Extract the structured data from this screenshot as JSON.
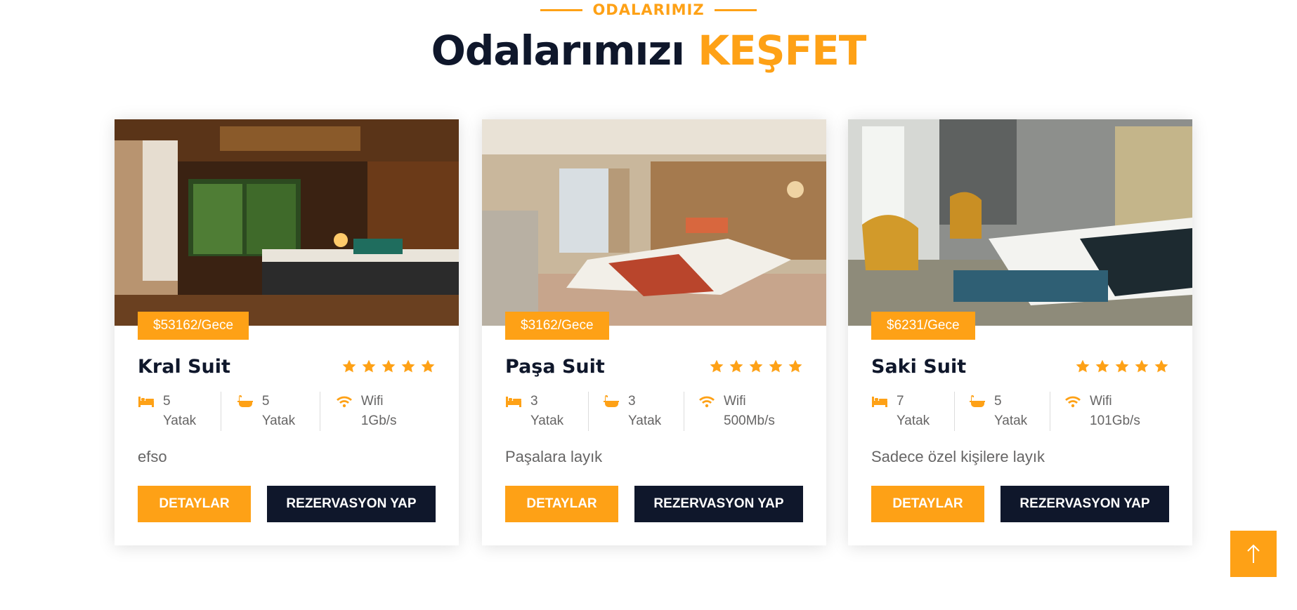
{
  "section": {
    "eyebrow": "ODALARIMIZ",
    "title_main": "Odalarımızı",
    "title_accent": "KEŞFET"
  },
  "colors": {
    "accent": "#fea116",
    "dark": "#0f172b",
    "text": "#666565"
  },
  "rooms": [
    {
      "price": "$53162/Gece",
      "name": "Kral Suit",
      "stars": 5,
      "beds": "5 Yatak",
      "baths": "5 Yatak",
      "wifi": "Wifi 1Gb/s",
      "description": "efso",
      "detail_label": "DETAYLAR",
      "reserve_label": "REZERVASYON YAP"
    },
    {
      "price": "$3162/Gece",
      "name": "Paşa Suit",
      "stars": 5,
      "beds": "3 Yatak",
      "baths": "3 Yatak",
      "wifi": "Wifi 500Mb/s",
      "description": "Paşalara layık",
      "detail_label": "DETAYLAR",
      "reserve_label": "REZERVASYON YAP"
    },
    {
      "price": "$6231/Gece",
      "name": "Saki Suit",
      "stars": 5,
      "beds": "7 Yatak",
      "baths": "5 Yatak",
      "wifi": "Wifi 101Gb/s",
      "description": "Sadece özel kişilere layık",
      "detail_label": "DETAYLAR",
      "reserve_label": "REZERVASYON YAP"
    }
  ],
  "icons": {
    "bed": "bed-icon",
    "bath": "bath-icon",
    "wifi": "wifi-icon",
    "star": "star-icon",
    "back_to_top": "arrow-up-icon"
  }
}
